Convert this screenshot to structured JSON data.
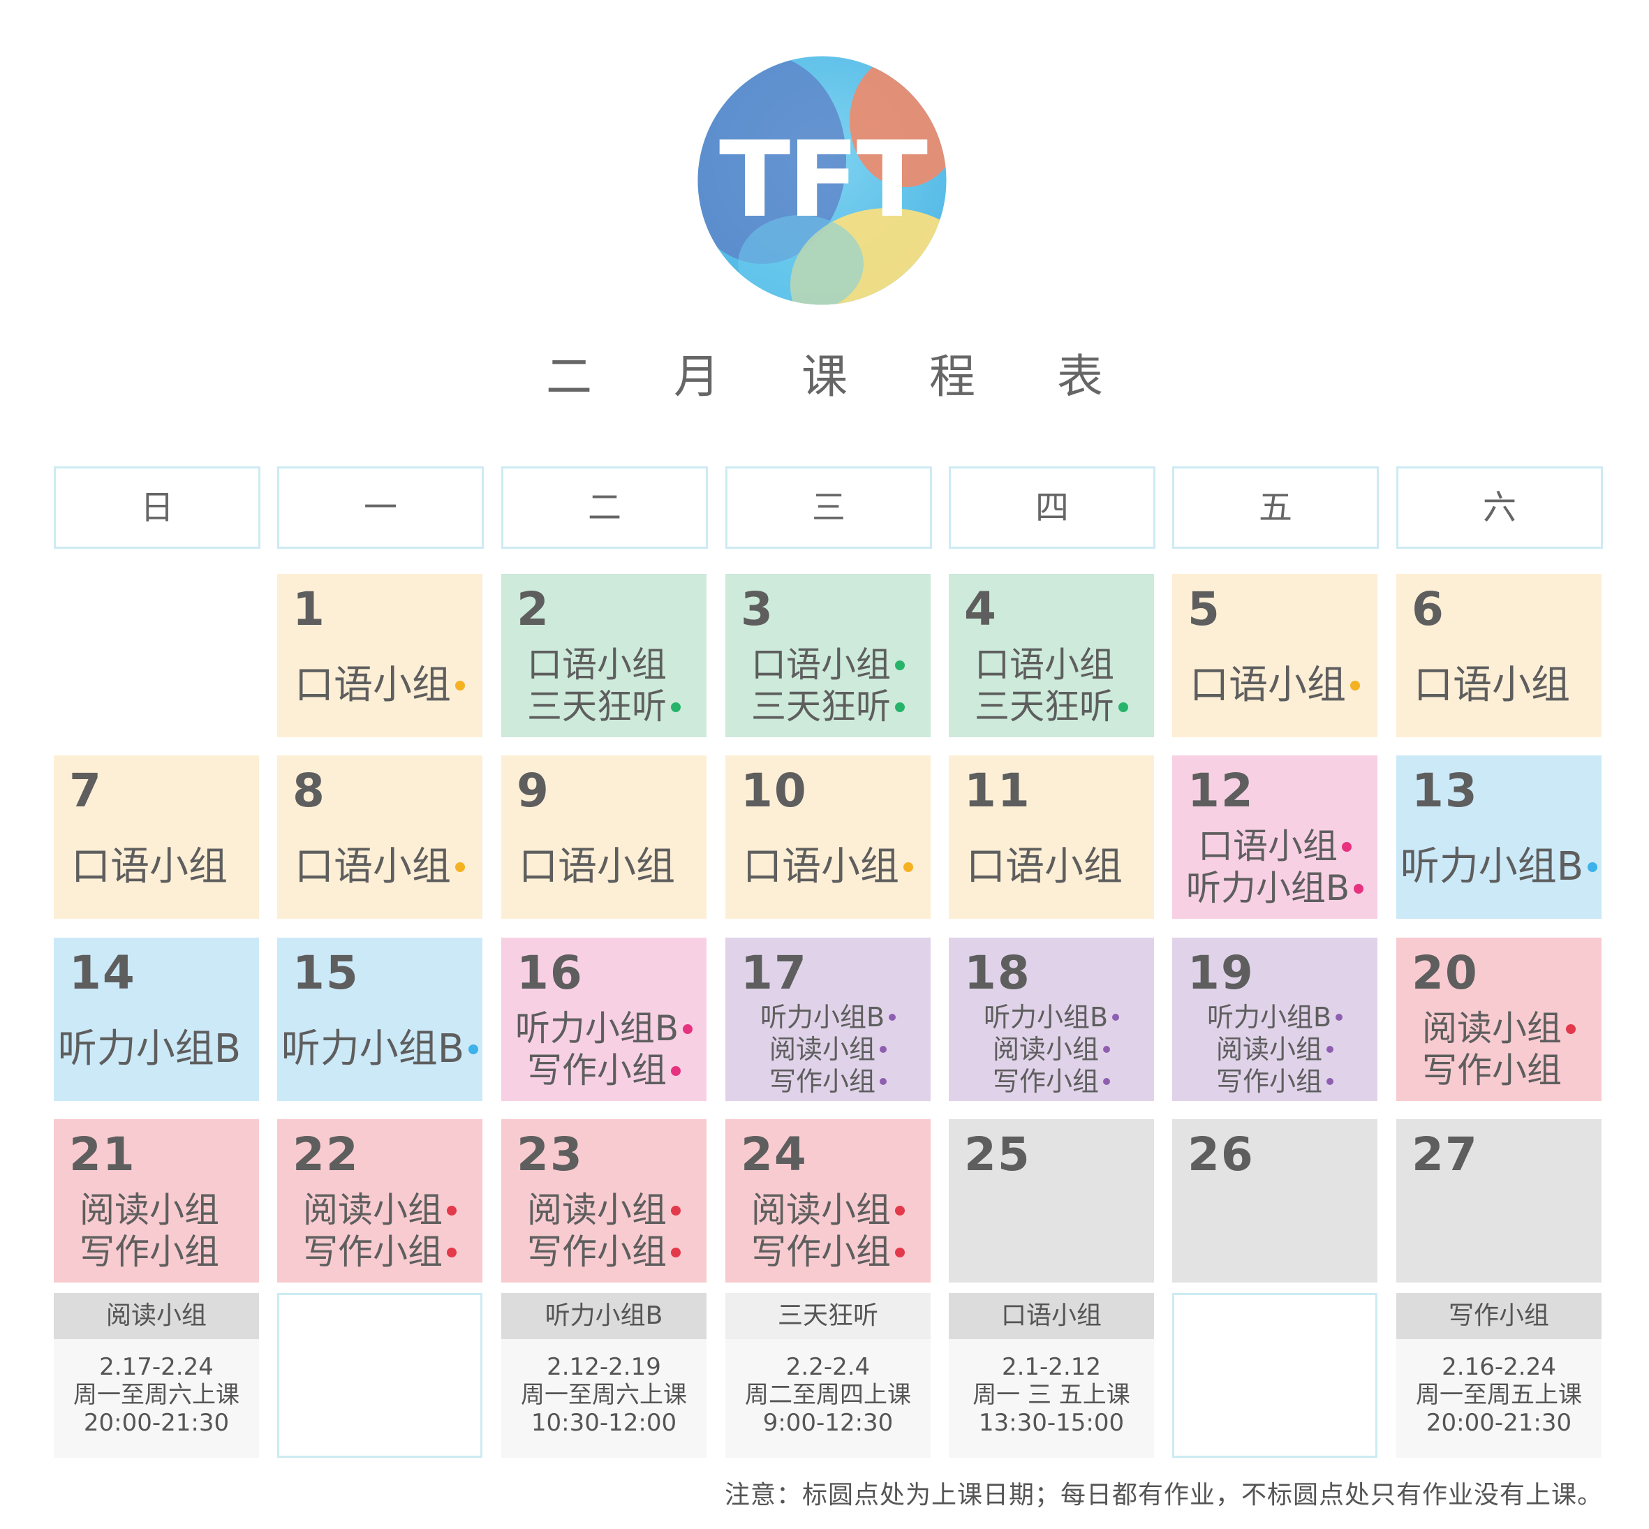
{
  "logo": {
    "text": "TFT"
  },
  "title": "二 月 课 程 表",
  "weekdays": [
    "日",
    "一",
    "二",
    "三",
    "四",
    "五",
    "六"
  ],
  "colors": {
    "yellow_dot": "#f4b223",
    "green_dot": "#27b36a",
    "pink_dot": "#e6327f",
    "blue_dot": "#3cb1ea",
    "purple_dot": "#8e5fb0",
    "red_dot": "#e23a4a"
  },
  "days": [
    {
      "n": "1",
      "bg": "y",
      "row": 0,
      "col": 1,
      "lines": [
        {
          "t": "口语小组",
          "dot": "yellow_dot"
        }
      ]
    },
    {
      "n": "2",
      "bg": "g",
      "row": 0,
      "col": 2,
      "lines": [
        {
          "t": "口语小组"
        },
        {
          "t": "三天狂听",
          "dot": "green_dot"
        }
      ]
    },
    {
      "n": "3",
      "bg": "g",
      "row": 0,
      "col": 3,
      "lines": [
        {
          "t": "口语小组",
          "dot": "green_dot"
        },
        {
          "t": "三天狂听",
          "dot": "green_dot"
        }
      ]
    },
    {
      "n": "4",
      "bg": "g",
      "row": 0,
      "col": 4,
      "lines": [
        {
          "t": "口语小组"
        },
        {
          "t": "三天狂听",
          "dot": "green_dot"
        }
      ]
    },
    {
      "n": "5",
      "bg": "y",
      "row": 0,
      "col": 5,
      "lines": [
        {
          "t": "口语小组",
          "dot": "yellow_dot"
        }
      ]
    },
    {
      "n": "6",
      "bg": "y",
      "row": 0,
      "col": 6,
      "lines": [
        {
          "t": "口语小组"
        }
      ]
    },
    {
      "n": "7",
      "bg": "y",
      "row": 1,
      "col": 0,
      "lines": [
        {
          "t": "口语小组"
        }
      ]
    },
    {
      "n": "8",
      "bg": "y",
      "row": 1,
      "col": 1,
      "lines": [
        {
          "t": "口语小组",
          "dot": "yellow_dot"
        }
      ]
    },
    {
      "n": "9",
      "bg": "y",
      "row": 1,
      "col": 2,
      "lines": [
        {
          "t": "口语小组"
        }
      ]
    },
    {
      "n": "10",
      "bg": "y",
      "row": 1,
      "col": 3,
      "lines": [
        {
          "t": "口语小组",
          "dot": "yellow_dot"
        }
      ]
    },
    {
      "n": "11",
      "bg": "y",
      "row": 1,
      "col": 4,
      "lines": [
        {
          "t": "口语小组"
        }
      ]
    },
    {
      "n": "12",
      "bg": "p",
      "row": 1,
      "col": 5,
      "lines": [
        {
          "t": "口语小组",
          "dot": "pink_dot"
        },
        {
          "t": "听力小组B",
          "dot": "pink_dot"
        }
      ]
    },
    {
      "n": "13",
      "bg": "b",
      "row": 1,
      "col": 6,
      "lines": [
        {
          "t": "听力小组B",
          "dot": "blue_dot"
        }
      ]
    },
    {
      "n": "14",
      "bg": "b",
      "row": 2,
      "col": 0,
      "lines": [
        {
          "t": "听力小组B"
        }
      ]
    },
    {
      "n": "15",
      "bg": "b",
      "row": 2,
      "col": 1,
      "lines": [
        {
          "t": "听力小组B",
          "dot": "blue_dot"
        }
      ]
    },
    {
      "n": "16",
      "bg": "p",
      "row": 2,
      "col": 2,
      "lines": [
        {
          "t": "听力小组B",
          "dot": "pink_dot"
        },
        {
          "t": "写作小组",
          "dot": "pink_dot"
        }
      ]
    },
    {
      "n": "17",
      "bg": "v",
      "row": 2,
      "col": 3,
      "lines": [
        {
          "t": "听力小组B",
          "dot": "purple_dot"
        },
        {
          "t": "阅读小组",
          "dot": "purple_dot"
        },
        {
          "t": "写作小组",
          "dot": "purple_dot"
        }
      ]
    },
    {
      "n": "18",
      "bg": "v",
      "row": 2,
      "col": 4,
      "lines": [
        {
          "t": "听力小组B",
          "dot": "purple_dot"
        },
        {
          "t": "阅读小组",
          "dot": "purple_dot"
        },
        {
          "t": "写作小组",
          "dot": "purple_dot"
        }
      ]
    },
    {
      "n": "19",
      "bg": "v",
      "row": 2,
      "col": 5,
      "lines": [
        {
          "t": "听力小组B",
          "dot": "purple_dot"
        },
        {
          "t": "阅读小组",
          "dot": "purple_dot"
        },
        {
          "t": "写作小组",
          "dot": "purple_dot"
        }
      ]
    },
    {
      "n": "20",
      "bg": "r",
      "row": 2,
      "col": 6,
      "lines": [
        {
          "t": "阅读小组",
          "dot": "red_dot"
        },
        {
          "t": "写作小组"
        }
      ]
    },
    {
      "n": "21",
      "bg": "r",
      "row": 3,
      "col": 0,
      "lines": [
        {
          "t": "阅读小组"
        },
        {
          "t": "写作小组"
        }
      ]
    },
    {
      "n": "22",
      "bg": "r",
      "row": 3,
      "col": 1,
      "lines": [
        {
          "t": "阅读小组",
          "dot": "red_dot"
        },
        {
          "t": "写作小组",
          "dot": "red_dot"
        }
      ]
    },
    {
      "n": "23",
      "bg": "r",
      "row": 3,
      "col": 2,
      "lines": [
        {
          "t": "阅读小组",
          "dot": "red_dot"
        },
        {
          "t": "写作小组",
          "dot": "red_dot"
        }
      ]
    },
    {
      "n": "24",
      "bg": "r",
      "row": 3,
      "col": 3,
      "lines": [
        {
          "t": "阅读小组",
          "dot": "red_dot"
        },
        {
          "t": "写作小组",
          "dot": "red_dot"
        }
      ]
    },
    {
      "n": "25",
      "bg": "gr",
      "row": 3,
      "col": 4,
      "lines": []
    },
    {
      "n": "26",
      "bg": "gr",
      "row": 3,
      "col": 5,
      "lines": []
    },
    {
      "n": "27",
      "bg": "gr",
      "row": 3,
      "col": 6,
      "lines": []
    }
  ],
  "schedules": [
    {
      "col": 0,
      "name": "阅读小组",
      "dates": "2.17-2.24",
      "days": "周一至周六上课",
      "time": "20:00-21:30"
    },
    {
      "col": 1,
      "empty": true
    },
    {
      "col": 2,
      "name": "听力小组B",
      "dates": "2.12-2.19",
      "days": "周一至周六上课",
      "time": "10:30-12:00"
    },
    {
      "col": 3,
      "name": "三天狂听",
      "dates": "2.2-2.4",
      "days": "周二至周四上课",
      "time": "9:00-12:30",
      "light": true
    },
    {
      "col": 4,
      "name": "口语小组",
      "dates": "2.1-2.12",
      "days": "周一 三 五上课",
      "time": "13:30-15:00"
    },
    {
      "col": 5,
      "empty": true
    },
    {
      "col": 6,
      "name": "写作小组",
      "dates": "2.16-2.24",
      "days": "周一至周五上课",
      "time": "20:00-21:30"
    }
  ],
  "note": "注意：标圆点处为上课日期；每日都有作业，不标圆点处只有作业没有上课。"
}
